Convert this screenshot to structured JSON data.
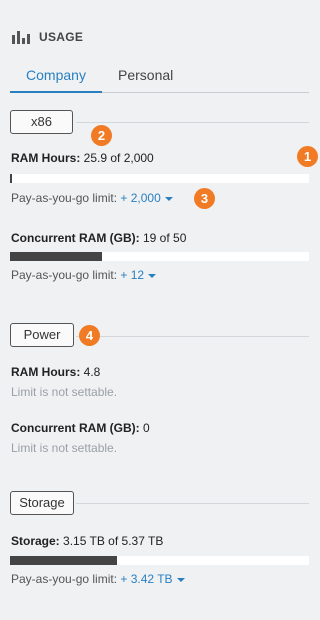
{
  "header": {
    "title": "USAGE",
    "icon": "bar-chart-icon"
  },
  "tabs": [
    {
      "label": "Company",
      "active": true
    },
    {
      "label": "Personal",
      "active": false
    }
  ],
  "colors": {
    "accent": "#2a7fc0",
    "badge": "#f07b24",
    "bar_fill": "#444444"
  },
  "sections": {
    "x86": {
      "chip": "x86",
      "ram_hours": {
        "label": "RAM Hours:",
        "value": "25.9 of 2,000",
        "progress": 0.013,
        "paygo_label": "Pay-as-you-go limit:",
        "paygo_value": "+ 2,000"
      },
      "concurrent": {
        "label": "Concurrent RAM (GB):",
        "value": "19 of 50",
        "progress": 0.38,
        "paygo_label": "Pay-as-you-go limit:",
        "paygo_value": "+ 12"
      }
    },
    "power": {
      "chip": "Power",
      "ram_hours": {
        "label": "RAM Hours:",
        "value": "4.8",
        "note": "Limit is not settable."
      },
      "concurrent": {
        "label": "Concurrent RAM (GB):",
        "value": "0",
        "note": "Limit is not settable."
      }
    },
    "storage": {
      "chip": "Storage",
      "storage": {
        "label": "Storage:",
        "value": "3.15 TB of 5.37 TB",
        "progress": 0.36,
        "paygo_label": "Pay-as-you-go limit:",
        "paygo_value": "+ 3.42 TB"
      }
    }
  },
  "badges": [
    "1",
    "2",
    "3",
    "4"
  ]
}
